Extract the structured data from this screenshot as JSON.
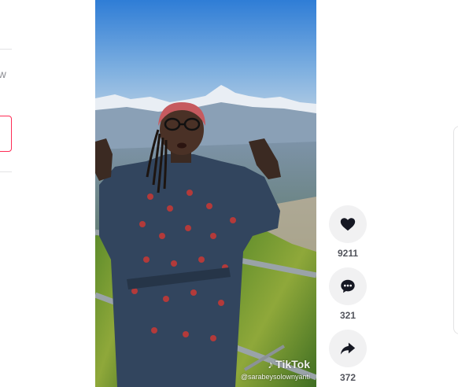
{
  "sidebar": {
    "following_text_fragment": "ew"
  },
  "video": {
    "watermark_logo": "TikTok",
    "watermark_handle": "@sarabeysolownyanti"
  },
  "actions": {
    "like": {
      "icon": "heart-icon",
      "count": "9211"
    },
    "comment": {
      "icon": "comment-icon",
      "count": "321"
    },
    "share": {
      "icon": "share-icon",
      "count": "372"
    }
  },
  "colors": {
    "accent": "#fe2c55",
    "action_circle_bg": "#f1f1f2",
    "icon": "#161823"
  }
}
